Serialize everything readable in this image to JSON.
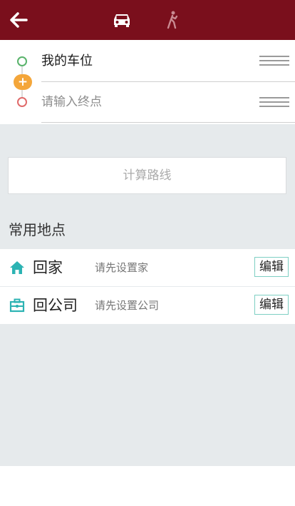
{
  "header": {
    "back_icon": "arrow-left-icon",
    "modes": [
      {
        "name": "car",
        "icon": "car-icon",
        "active": true
      },
      {
        "name": "walk",
        "icon": "walk-icon",
        "active": false
      }
    ]
  },
  "route": {
    "start": "我的车位",
    "end_placeholder": "请输入终点"
  },
  "calculate_label": "计算路线",
  "common_places": {
    "title": "常用地点",
    "items": [
      {
        "icon": "home-icon",
        "name": "回家",
        "hint": "请先设置家",
        "edit_label": "编辑"
      },
      {
        "icon": "briefcase-icon",
        "name": "回公司",
        "hint": "请先设置公司",
        "edit_label": "编辑"
      }
    ]
  },
  "colors": {
    "header": "#7a0f1c",
    "start_dot": "#59b36b",
    "end_dot": "#e06a6a",
    "add_waypoint": "#f4a63a",
    "place_icon": "#2cb3b3",
    "background": "#e6eaec"
  }
}
